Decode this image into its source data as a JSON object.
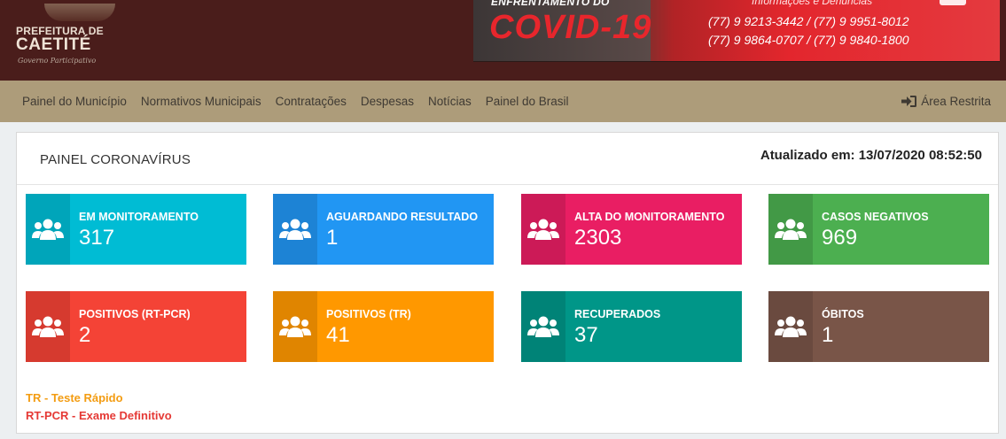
{
  "header": {
    "logo": {
      "line1": "PREFEITURA DE",
      "line2": "CAETITÉ",
      "tagline": "Governo Participativo"
    },
    "banner": {
      "top_text": "ENFRENTAMENTO DO",
      "headline": "COVID-19",
      "info_label": "Informações e Denúncias",
      "phones_line1": "(77) 9 9213-3442  /  (77) 9 9951-8012",
      "phones_line2": "(77) 9 9864-0707  /  (77) 9 9840-1800"
    }
  },
  "nav": {
    "items": [
      {
        "label": "Painel do Município"
      },
      {
        "label": "Normativos Municipais"
      },
      {
        "label": "Contratações"
      },
      {
        "label": "Despesas"
      },
      {
        "label": "Notícias"
      },
      {
        "label": "Painel do Brasil"
      }
    ],
    "restricted": {
      "label": "Área Restrita",
      "icon": "sign-in-icon"
    }
  },
  "panel": {
    "title": "PAINEL CORONAVÍRUS",
    "updated": "Atualizado em: 13/07/2020 08:52:50"
  },
  "cards": [
    {
      "label": "EM MONITORAMENTO",
      "value": "317",
      "color": "#00bcd4",
      "icon": "users-icon"
    },
    {
      "label": "AGUARDANDO RESULTADO",
      "value": "1",
      "color": "#2196f3",
      "icon": "users-icon"
    },
    {
      "label": "ALTA DO MONITORAMENTO",
      "value": "2303",
      "color": "#e91e63",
      "icon": "users-icon"
    },
    {
      "label": "CASOS NEGATIVOS",
      "value": "969",
      "color": "#4caf50",
      "icon": "users-icon"
    },
    {
      "label": "POSITIVOS (RT-PCR)",
      "value": "2",
      "color": "#f44336",
      "icon": "users-icon"
    },
    {
      "label": "POSITIVOS (TR)",
      "value": "41",
      "color": "#ff9800",
      "icon": "users-icon"
    },
    {
      "label": "RECUPERADOS",
      "value": "37",
      "color": "#009688",
      "icon": "users-icon"
    },
    {
      "label": "ÓBITOS",
      "value": "1",
      "color": "#795548",
      "icon": "users-icon"
    }
  ],
  "legend": {
    "tr": "TR - Teste Rápido",
    "rtpcr": "RT-PCR - Exame Definitivo",
    "tr_color": "#f39c12",
    "rtpcr_color": "#e53935"
  }
}
